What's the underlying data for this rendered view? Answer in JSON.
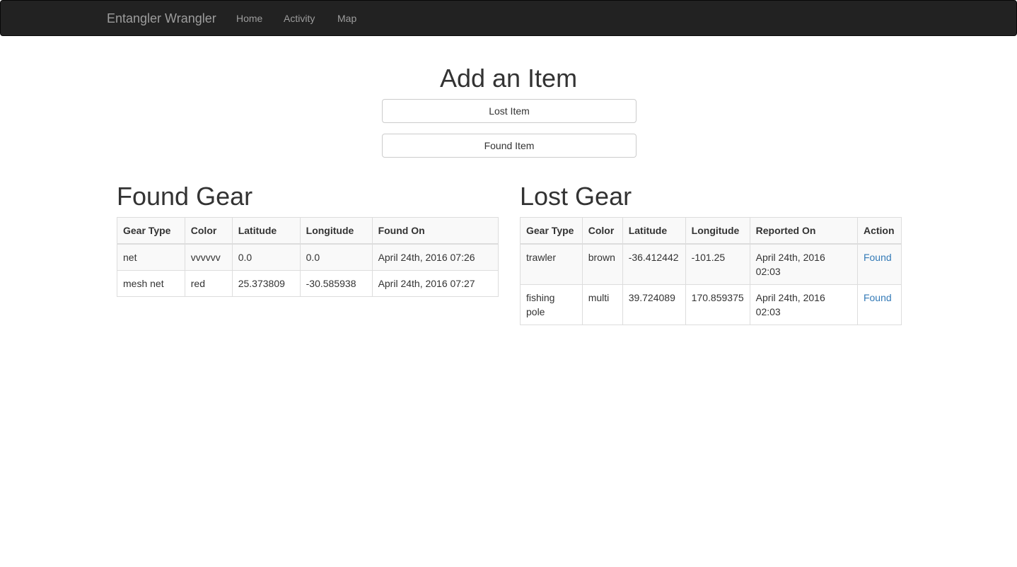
{
  "navbar": {
    "brand": "Entangler Wrangler",
    "links": [
      "Home",
      "Activity",
      "Map"
    ]
  },
  "add_item": {
    "title": "Add an Item",
    "lost_button": "Lost Item",
    "found_button": "Found Item"
  },
  "found_gear": {
    "title": "Found Gear",
    "headers": [
      "Gear Type",
      "Color",
      "Latitude",
      "Longitude",
      "Found On"
    ],
    "rows": [
      [
        "net",
        "vvvvvv",
        "0.0",
        "0.0",
        "April 24th, 2016 07:26"
      ],
      [
        "mesh net",
        "red",
        "25.373809",
        "-30.585938",
        "April 24th, 2016 07:27"
      ]
    ]
  },
  "lost_gear": {
    "title": "Lost Gear",
    "headers": [
      "Gear Type",
      "Color",
      "Latitude",
      "Longitude",
      "Reported On",
      "Action"
    ],
    "rows": [
      [
        "trawler",
        "brown",
        "-36.412442",
        "-101.25",
        "April 24th, 2016 02:03",
        "Found"
      ],
      [
        "fishing pole",
        "multi",
        "39.724089",
        "170.859375",
        "April 24th, 2016 02:03",
        "Found"
      ]
    ]
  },
  "colors": {
    "navbar_bg": "#222222",
    "nav_text": "#9d9d9d",
    "link": "#337ab7"
  }
}
